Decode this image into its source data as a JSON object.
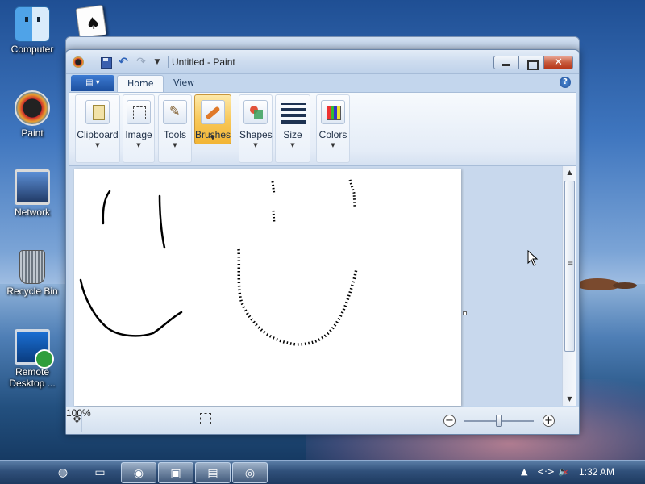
{
  "desktop": {
    "icons": [
      {
        "label": "Computer",
        "icon": "finder-icon"
      },
      {
        "label": "Paint",
        "icon": "paint-icon"
      },
      {
        "label": "Network",
        "icon": "network-icon"
      },
      {
        "label": "Recycle Bin",
        "icon": "recycle-bin-icon"
      },
      {
        "label": "Remote Desktop ...",
        "icon": "remote-desktop-icon"
      }
    ],
    "extra_icon": "solitaire-cards-icon"
  },
  "window": {
    "title": "Untitled - Paint",
    "quick_access": [
      "save-icon",
      "undo-icon",
      "redo-icon",
      "customize-icon"
    ],
    "tabs": [
      {
        "label": "Home",
        "active": true
      },
      {
        "label": "View",
        "active": false
      }
    ],
    "help_glyph": "?",
    "ribbon": {
      "groups": [
        {
          "label": "Clipboard",
          "icon": "clipboard-icon"
        },
        {
          "label": "Image",
          "icon": "image-select-icon"
        },
        {
          "label": "Tools",
          "icon": "tools-icon"
        },
        {
          "label": "Brushes",
          "icon": "brushes-icon",
          "active": true
        },
        {
          "label": "Shapes",
          "icon": "shapes-icon"
        },
        {
          "label": "Size",
          "icon": "size-icon"
        },
        {
          "label": "Colors",
          "icon": "colors-icon"
        }
      ],
      "dropdown_glyph": "▼"
    },
    "status": {
      "zoom": "100%",
      "zoom_out_glyph": "−",
      "zoom_in_glyph": "+",
      "zoom_level_fraction": 0.5
    },
    "controls": {
      "minimize": "minimize-icon",
      "maximize": "maximize-icon",
      "close_glyph": "✕"
    }
  },
  "taskbar": {
    "apple_glyph": "",
    "time": "1:32 AM",
    "tray_up_glyph": "▲",
    "tray_net_glyph": "<·>",
    "tray_vol_glyph": "🔈"
  },
  "colors": {
    "brushes_active": "#f8c85a",
    "close_button": "#c75a3c",
    "canvas_bg": "#ffffff",
    "window_frame": "#c3d6ed"
  }
}
